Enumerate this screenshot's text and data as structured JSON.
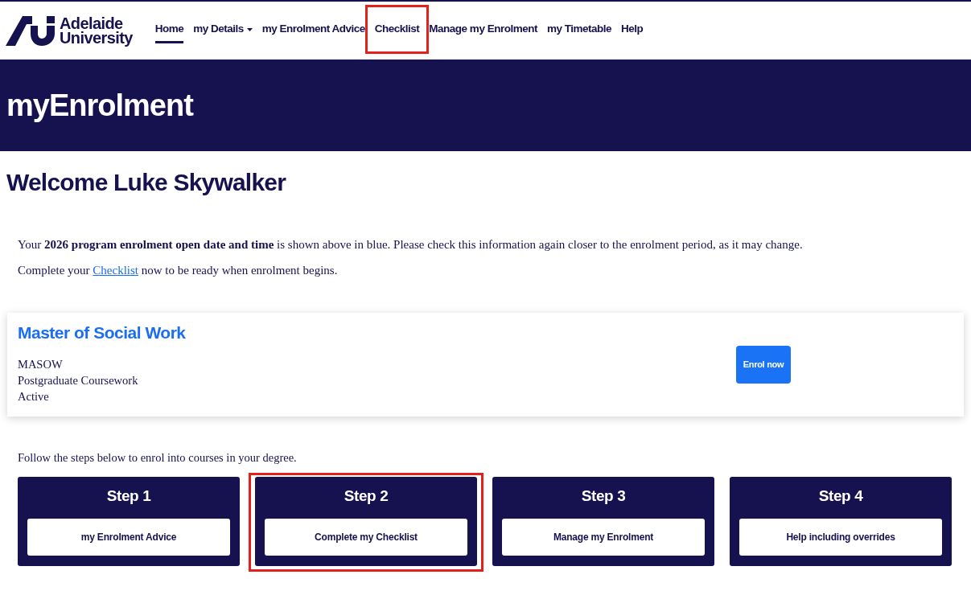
{
  "header": {
    "logo": {
      "line1": "Adelaide",
      "line2": "University"
    },
    "nav": {
      "items": [
        {
          "label": "Home",
          "selected": true,
          "dropdown": false,
          "highlighted": false
        },
        {
          "label": "my Details",
          "selected": false,
          "dropdown": true,
          "highlighted": false
        },
        {
          "label": "my Enrolment Advice",
          "selected": false,
          "dropdown": false,
          "highlighted": false
        },
        {
          "label": "Checklist",
          "selected": false,
          "dropdown": false,
          "highlighted": true
        },
        {
          "label": "Manage my Enrolment",
          "selected": false,
          "dropdown": false,
          "highlighted": false
        },
        {
          "label": "my Timetable",
          "selected": false,
          "dropdown": false,
          "highlighted": false
        },
        {
          "label": "Help",
          "selected": false,
          "dropdown": false,
          "highlighted": false
        }
      ]
    }
  },
  "banner": {
    "title": "myEnrolment"
  },
  "welcome": "Welcome Luke Skywalker",
  "intro": {
    "paragraph_1": "Your **2026 program enrolment open date and time** is shown above in blue. Please check this information again closer to the enrolment period, as it may change.",
    "paragraph_2": {
      "before": "Complete your",
      "link": "Checklist",
      "after": "now to be ready when enrolment begins."
    }
  },
  "program": {
    "title": "Master of Social Work",
    "lines": [
      "MASOW",
      "Postgraduate Coursework",
      "Active"
    ],
    "button": "Enrol now"
  },
  "steps": {
    "intro": "Follow the steps below to enrol into courses in your degree.",
    "items": [
      {
        "title": "Step 1",
        "button": "my Enrolment Advice",
        "highlighted": false
      },
      {
        "title": "Step 2",
        "button": "Complete my Checklist",
        "highlighted": true
      },
      {
        "title": "Step 3",
        "button": "Manage my Enrolment",
        "highlighted": false
      },
      {
        "title": "Step 4",
        "button": "Help including overrides",
        "highlighted": false
      }
    ]
  }
}
